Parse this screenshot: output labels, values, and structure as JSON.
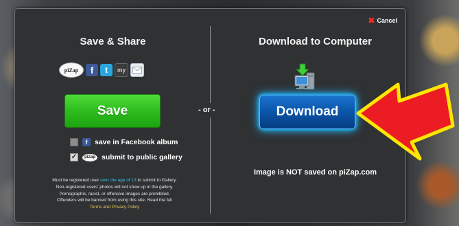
{
  "dialog": {
    "cancel_label": "Cancel",
    "left": {
      "title": "Save & Share",
      "share_icons": [
        "pizap-icon",
        "facebook-icon",
        "twitter-icon",
        "myspace-icon",
        "email-icon"
      ],
      "pizap_icon_text": "piZap",
      "myspace_icon_text": "my",
      "save_label": "Save",
      "options": [
        {
          "label": "save in Facebook album",
          "checked": false,
          "icon": "facebook-icon"
        },
        {
          "label": "submit to public gallery",
          "checked": true,
          "icon": "pizap-icon",
          "icon_text": "piZap"
        }
      ],
      "disclaimer": {
        "part1": "Must be registered user ",
        "age_link": "over the age of 13",
        "part2": " to submit to Gallery.",
        "line2": "Non-registered users' photos will not show up in the gallery.",
        "line3": "Pornographic, racist, or offensive images are prohibited.",
        "line4": "Offenders will be banned from using this site. Read the full",
        "terms_link": "Terms and Privacy Policy"
      }
    },
    "or_label": "- or -",
    "right": {
      "title": "Download to Computer",
      "icon": "computer-download-icon",
      "download_label": "Download",
      "notice": "Image is NOT saved on piZap.com"
    }
  },
  "annotation": {
    "icon": "red-arrow-icon",
    "fill": "#ec1c24",
    "outline": "#ffe600"
  },
  "colors": {
    "save_green": "#2dbd1d",
    "download_blue": "#0b55a8",
    "link_blue": "#3cc1e8",
    "link_gold": "#e3c75a",
    "cancel_red": "#e8322b"
  }
}
